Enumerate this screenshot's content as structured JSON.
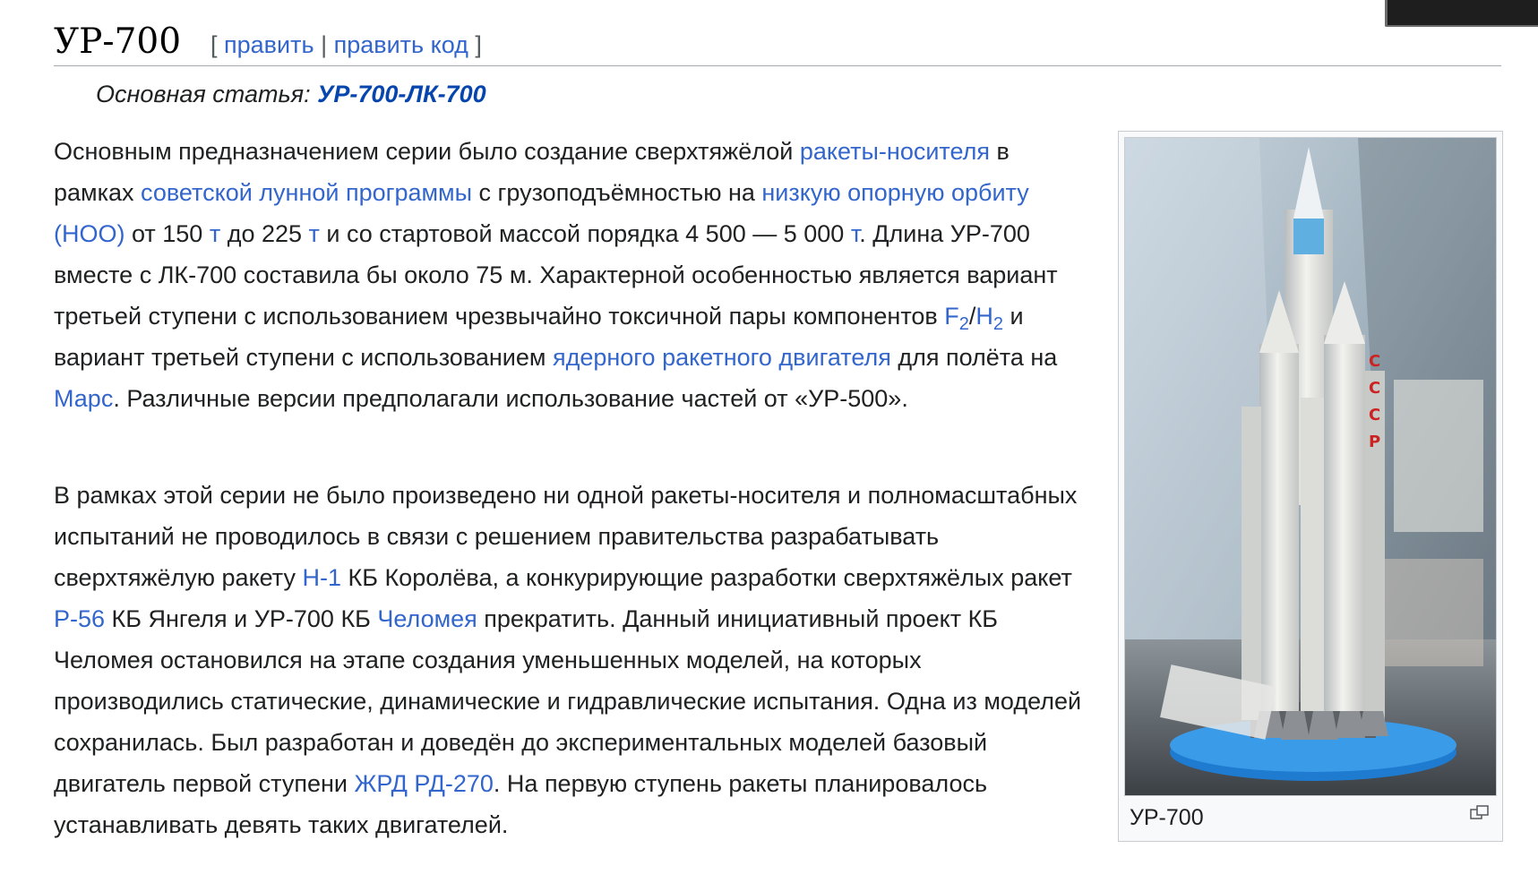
{
  "section": {
    "title": "УР-700",
    "edit_open": "[",
    "edit_label": "править",
    "edit_sep": "|",
    "edit_code_label": "править код",
    "edit_close": "]"
  },
  "hatnote": {
    "prefix": "Основная статья: ",
    "link": "УР-700-ЛК-700"
  },
  "p1": {
    "t1": "Основным предназначением серии было создание сверхтяжёлой ",
    "l1": "ракеты-носителя",
    "t2": " в рамках ",
    "l2": "советской лунной программы",
    "t3": " с грузоподъёмностью на ",
    "l3": "низкую опорную орбиту (НОО)",
    "t4": " от 150 ",
    "l4": "т",
    "t5": " до 225 ",
    "l5": "т",
    "t6": " и со стартовой массой порядка 4 500 — 5 000 ",
    "l6": "т",
    "t7": ". Длина УР-700 вместе с ЛК-700 составила бы около 75 м. Характерной особенностью является вариант третьей ступени с использованием чрезвычайно токсичной пары компонентов ",
    "l7a": "F",
    "l7a_sub": "2",
    "slash": "/",
    "l7b": "H",
    "l7b_sub": "2",
    "t8": " и вариант третьей ступени с использованием ",
    "l8": "ядерного ракетного двигателя",
    "t9": " для полёта на ",
    "l9": "Марс",
    "t10": ". Различные версии предполагали использование частей от «УР-500»."
  },
  "p2": {
    "t1": "В рамках этой серии не было произведено ни одной ракеты-носителя и полномасштабных испытаний не проводилось в связи с решением правительства разрабатывать сверхтяжёлую ракету ",
    "l1": "Н-1",
    "t2": " КБ Королёва, а конкурирующие разработки сверхтяжёлых ракет ",
    "l2": "Р-56",
    "t3": " КБ Янгеля и УР-700 КБ ",
    "l3": "Челомея",
    "t4": " прекратить. Данный инициативный проект КБ Челомея остановился на этапе создания уменьшенных моделей, на которых производились статические, динамические и гидравлические испытания. Одна из моделей сохранилась. Был разработан и доведён до экспериментальных моделей базовый двигатель первой ступени ",
    "l4": "ЖРД РД-270",
    "t5": ". На первую ступень ракеты планировалось устанавливать девять таких двигателей."
  },
  "thumb": {
    "caption": "УР-700",
    "rocket_text": "СССР",
    "icon": "magnify-clip-icon"
  }
}
